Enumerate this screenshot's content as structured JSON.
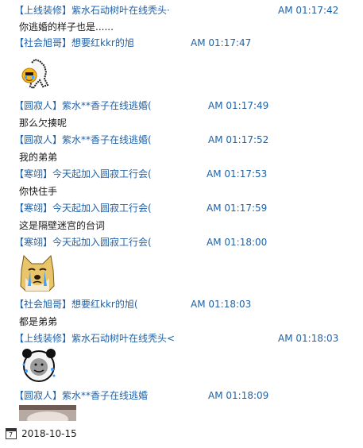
{
  "messages": [
    {
      "sender": "【上线装修】紫水石动树叶在线秃头·",
      "time": "AM 01:17:42",
      "text": "你逃婚的样子也是......"
    },
    {
      "sender": "【社会旭哥】想要红kkr的旭",
      "time": "AM 01:17:47",
      "sticker": "waving-emoji-sticker-icon"
    },
    {
      "sender": "【圆寂人】紫水**香子在线逃婚(",
      "time": "AM 01:17:49",
      "text": "那么欠揍呢"
    },
    {
      "sender": "【圆寂人】紫水**香子在线逃婚(",
      "time": "AM 01:17:52",
      "text": "我的弟弟"
    },
    {
      "sender": "【寒翊】今天起加入圆寂工行会(",
      "time": "AM 01:17:53",
      "text": "你快住手"
    },
    {
      "sender": "【寒翊】今天起加入圆寂工行会(",
      "time": "AM 01:17:59",
      "text": "这是隔壁迷宫的台词"
    },
    {
      "sender": "【寒翊】今天起加入圆寂工行会(",
      "time": "AM 01:18:00",
      "sticker": "crying-doge-sticker-icon"
    },
    {
      "sender": "【社会旭哥】想要红kkr的旭(",
      "time": "AM 01:18:03",
      "text": "都是弟弟"
    },
    {
      "sender": "【上线装修】紫水石动树叶在线秃头<",
      "time": "AM 01:18:03",
      "sticker": "panda-meme-sticker-icon"
    },
    {
      "sender": "【圆寂人】紫水**香子在线逃婚",
      "time": "AM 01:18:09",
      "sticker": "partial-sticker-icon"
    }
  ],
  "footer": {
    "date": "2018-10-15",
    "calendar_glyph": "7"
  }
}
